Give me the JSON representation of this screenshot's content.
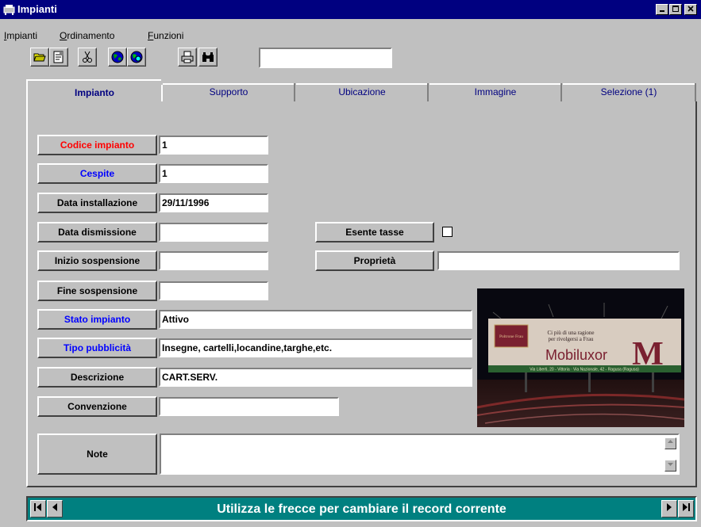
{
  "window": {
    "title": "Impianti"
  },
  "menu": {
    "items": [
      "Impianti",
      "Ordinamento",
      "Funzioni"
    ]
  },
  "toolbar": {
    "icons": [
      "open-folder-icon",
      "properties-icon",
      "cut-icon",
      "globe-icon",
      "globe-search-icon",
      "print-icon",
      "binoculars-icon"
    ],
    "search_value": ""
  },
  "tabs": [
    "Impianto",
    "Supporto",
    "Ubicazione",
    "Immagine",
    "Selezione (1)"
  ],
  "active_tab": "Impianto",
  "form": {
    "codice_impianto": {
      "label": "Codice impianto",
      "value": "1"
    },
    "cespite": {
      "label": "Cespite",
      "value": "1"
    },
    "data_installazione": {
      "label": "Data installazione",
      "value": "29/11/1996"
    },
    "data_dismissione": {
      "label": "Data dismissione",
      "value": ""
    },
    "esente_tasse": {
      "label": "Esente tasse",
      "checked": false
    },
    "inizio_sospensione": {
      "label": "Inizio sospensione",
      "value": ""
    },
    "proprieta": {
      "label": "Proprietà",
      "value": ""
    },
    "fine_sospensione": {
      "label": "Fine sospensione",
      "value": ""
    },
    "stato_impianto": {
      "label": "Stato impianto",
      "value": "Attivo"
    },
    "tipo_pubblicita": {
      "label": "Tipo pubblicità",
      "value": "Insegne, cartelli,locandine,targhe,etc."
    },
    "descrizione": {
      "label": "Descrizione",
      "value": "CART.SERV."
    },
    "convenzione": {
      "label": "Convenzione",
      "value": ""
    },
    "note": {
      "label": "Note",
      "value": ""
    }
  },
  "photo": {
    "billboard_lines": [
      "Ci più di una ragione",
      "per rivolgersi a Frau",
      "Mobiluxor",
      "M"
    ],
    "small_sign": "Poltrone Frau",
    "footer_text": "Via Liberti, 20 - Vittoria · Via Nazionale, 42 - Ragusa (Ragusa)"
  },
  "status": {
    "message": "Utilizza le frecce per cambiare il record corrente"
  },
  "colors": {
    "title_bar": "#000080",
    "nav_bar": "#008080",
    "label_red": "#ff0000",
    "label_blue": "#0000ff"
  }
}
